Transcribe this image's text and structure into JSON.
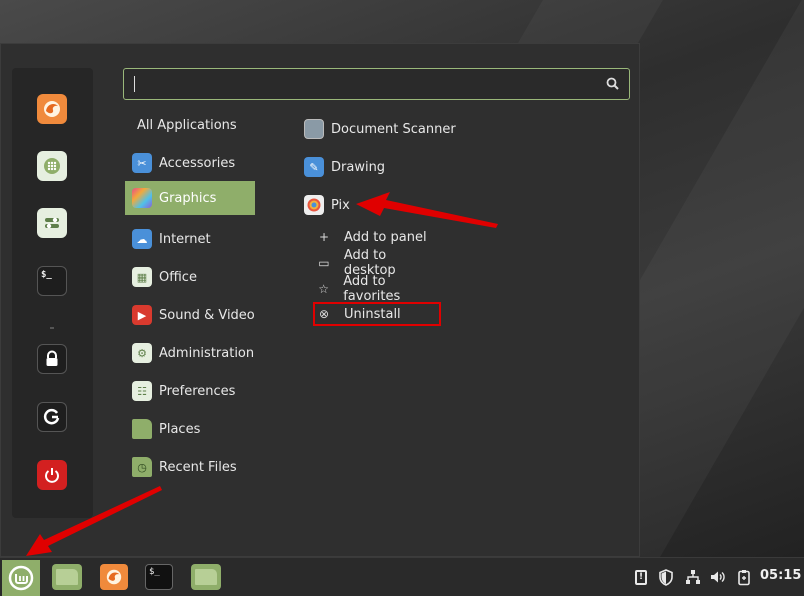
{
  "search": {
    "value": "",
    "placeholder": ""
  },
  "favorites": [
    {
      "name": "firefox-icon"
    },
    {
      "name": "software-manager-icon"
    },
    {
      "name": "settings-icon"
    },
    {
      "name": "terminal-icon",
      "label": "$_"
    },
    {
      "name": "lock-screen-icon"
    },
    {
      "name": "logout-icon"
    },
    {
      "name": "power-icon"
    }
  ],
  "categories": [
    {
      "label": "All Applications"
    },
    {
      "label": "Accessories",
      "icon": "scissors-icon"
    },
    {
      "label": "Graphics",
      "icon": "graphics-icon",
      "active": true
    },
    {
      "label": "Internet",
      "icon": "cloud-icon"
    },
    {
      "label": "Office",
      "icon": "office-icon"
    },
    {
      "label": "Sound & Video",
      "icon": "play-icon"
    },
    {
      "label": "Administration",
      "icon": "administration-icon"
    },
    {
      "label": "Preferences",
      "icon": "preferences-icon"
    },
    {
      "label": "Places",
      "icon": "folder-icon"
    },
    {
      "label": "Recent Files",
      "icon": "recent-folder-icon"
    }
  ],
  "apps": [
    {
      "label": "Document Scanner",
      "icon": "scanner-icon"
    },
    {
      "label": "Drawing",
      "icon": "drawing-icon"
    },
    {
      "label": "Pix",
      "icon": "pix-icon"
    }
  ],
  "context_menu": [
    {
      "label": "Add to panel",
      "icon": "plus-icon",
      "glyph": "+"
    },
    {
      "label": "Add to desktop",
      "icon": "monitor-icon",
      "glyph": "▭"
    },
    {
      "label": "Add to favorites",
      "icon": "star-icon",
      "glyph": "☆"
    },
    {
      "label": "Uninstall",
      "icon": "remove-icon",
      "glyph": "⊗"
    }
  ],
  "taskbar": {
    "terminal_label": "$_",
    "clock": "05:15"
  },
  "colors": {
    "accent": "#8fae6a",
    "annotation": "#e00000",
    "panel": "#2f2f2f"
  }
}
